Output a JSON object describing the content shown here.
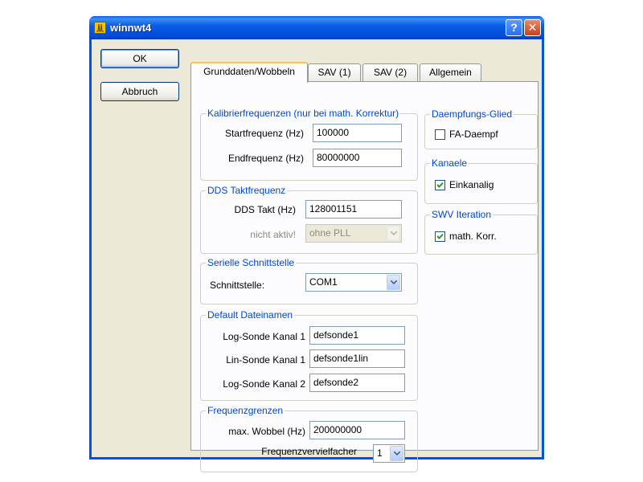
{
  "window": {
    "title": "winnwt4",
    "help_glyph": "?",
    "close_glyph": "✕"
  },
  "buttons": {
    "ok": "OK",
    "cancel": "Abbruch"
  },
  "tabs": [
    {
      "label": "Grunddaten/Wobbeln",
      "active": true
    },
    {
      "label": "SAV (1)",
      "active": false
    },
    {
      "label": "SAV (2)",
      "active": false
    },
    {
      "label": "Allgemein",
      "active": false
    }
  ],
  "kalibrier": {
    "title": "Kalibrierfrequenzen (nur bei math. Korrektur)",
    "start_label": "Startfrequenz (Hz)",
    "start_value": "100000",
    "end_label": "Endfrequenz (Hz)",
    "end_value": "80000000"
  },
  "dds": {
    "title": "DDS Taktfrequenz",
    "takt_label": "DDS Takt (Hz)",
    "takt_value": "128001151",
    "pll_label": "nicht aktiv!",
    "pll_value": "ohne PLL"
  },
  "seriell": {
    "title": "Serielle Schnittstelle",
    "port_label": "Schnittstelle:",
    "port_value": "COM1"
  },
  "dateinamen": {
    "title": "Default Dateinamen",
    "log1_label": "Log-Sonde Kanal 1",
    "log1_value": "defsonde1",
    "lin1_label": "Lin-Sonde Kanal 1",
    "lin1_value": "defsonde1lin",
    "log2_label": "Log-Sonde Kanal 2",
    "log2_value": "defsonde2"
  },
  "grenzen": {
    "title": "Frequenzgrenzen",
    "max_label": "max. Wobbel (Hz)",
    "max_value": "200000000",
    "mult_label": "Frequenzvervielfacher",
    "mult_value": "1"
  },
  "daempfung": {
    "title": "Daempfungs-Glied",
    "fa_label": "FA-Daempf",
    "fa_checked": false
  },
  "kanaele": {
    "title": "Kanaele",
    "ein_label": "Einkanalig",
    "ein_checked": true
  },
  "swv": {
    "title": "SWV Iteration",
    "math_label": "math. Korr.",
    "math_checked": true
  },
  "colors": {
    "titlebar": "#0a5fe6",
    "group_title": "#0046d5",
    "dialog_bg": "#ece9d8",
    "panel_bg": "#fcfcfe",
    "tab_highlight": "#ffc83c"
  }
}
